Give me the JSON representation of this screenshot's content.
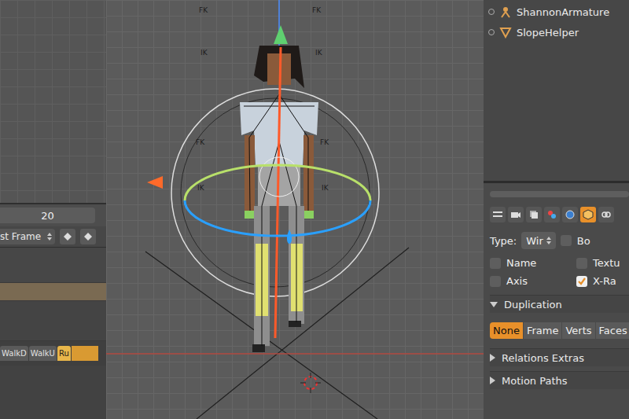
{
  "outliner": {
    "items": [
      {
        "name": "ShannonArmature",
        "kind": "armature"
      },
      {
        "name": "SlopeHelper",
        "kind": "mesh"
      }
    ]
  },
  "timeline": {
    "frame": "20",
    "dropdown": "st Frame"
  },
  "nla": {
    "strips": [
      {
        "label": "WalkD",
        "selected": false
      },
      {
        "label": "WalkU",
        "selected": false
      },
      {
        "label": "Ru",
        "selected": true
      }
    ]
  },
  "viewport": {
    "labels": [
      "FK",
      "IK",
      "FK",
      "IK",
      "FK",
      "IK",
      "FK",
      "IK"
    ]
  },
  "properties": {
    "tabs": [
      {
        "kind": "menu",
        "selected": false
      },
      {
        "kind": "render",
        "selected": false
      },
      {
        "kind": "layers",
        "selected": false
      },
      {
        "kind": "scene",
        "selected": false
      },
      {
        "kind": "world",
        "selected": false
      },
      {
        "kind": "object",
        "selected": true
      },
      {
        "kind": "link",
        "selected": false
      }
    ],
    "type": {
      "label": "Type:",
      "value": "Wir"
    },
    "checkboxes": [
      {
        "label": "Bo",
        "checked": false
      },
      {
        "label": "Name",
        "checked": false
      },
      {
        "label": "Textu",
        "checked": false
      },
      {
        "label": "Axis",
        "checked": false
      },
      {
        "label": "X-Ra",
        "checked": true
      }
    ],
    "duplication": {
      "title": "Duplication",
      "expanded": true,
      "options": [
        {
          "label": "None",
          "selected": true
        },
        {
          "label": "Frame",
          "selected": false
        },
        {
          "label": "Verts",
          "selected": false
        },
        {
          "label": "Faces",
          "selected": false
        }
      ]
    },
    "sections": [
      {
        "title": "Relations Extras",
        "expanded": false
      },
      {
        "title": "Motion Paths",
        "expanded": false
      }
    ]
  }
}
